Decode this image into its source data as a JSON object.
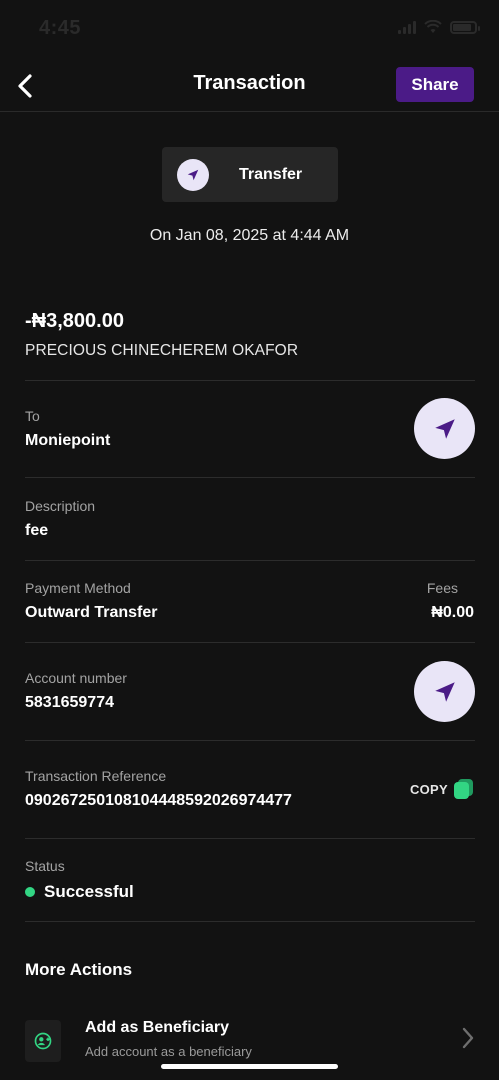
{
  "status_bar": {
    "time": "4:45"
  },
  "header": {
    "title": "Transaction",
    "share_label": "Share"
  },
  "transaction_type": {
    "label": "Transfer"
  },
  "datetime": "On Jan 08, 2025 at 4:44 AM",
  "amount": "-₦3,800.00",
  "counterparty": "PRECIOUS CHINECHEREM OKAFOR",
  "fields": {
    "to": {
      "label": "To",
      "value": "Moniepoint"
    },
    "description": {
      "label": "Description",
      "value": "fee"
    },
    "payment_method": {
      "label": "Payment Method",
      "value": "Outward Transfer"
    },
    "fees": {
      "label": "Fees",
      "value": "₦0.00"
    },
    "account_number": {
      "label": "Account number",
      "value": "5831659774"
    },
    "reference": {
      "label": "Transaction Reference",
      "value": "090267250108104448592026974477",
      "copy_label": "COPY"
    },
    "status": {
      "label": "Status",
      "value": "Successful"
    }
  },
  "more_actions": {
    "title": "More Actions",
    "items": [
      {
        "title": "Add as Beneficiary",
        "subtitle": "Add account as a beneficiary"
      }
    ]
  },
  "colors": {
    "background": "#121212",
    "accent_purple": "#4b1b87",
    "success_green": "#32d583",
    "icon_bg": "#e9e5f7"
  },
  "icons": [
    "back-arrow-icon",
    "send-icon",
    "copy-icon",
    "user-add-icon",
    "chevron-right-icon"
  ]
}
